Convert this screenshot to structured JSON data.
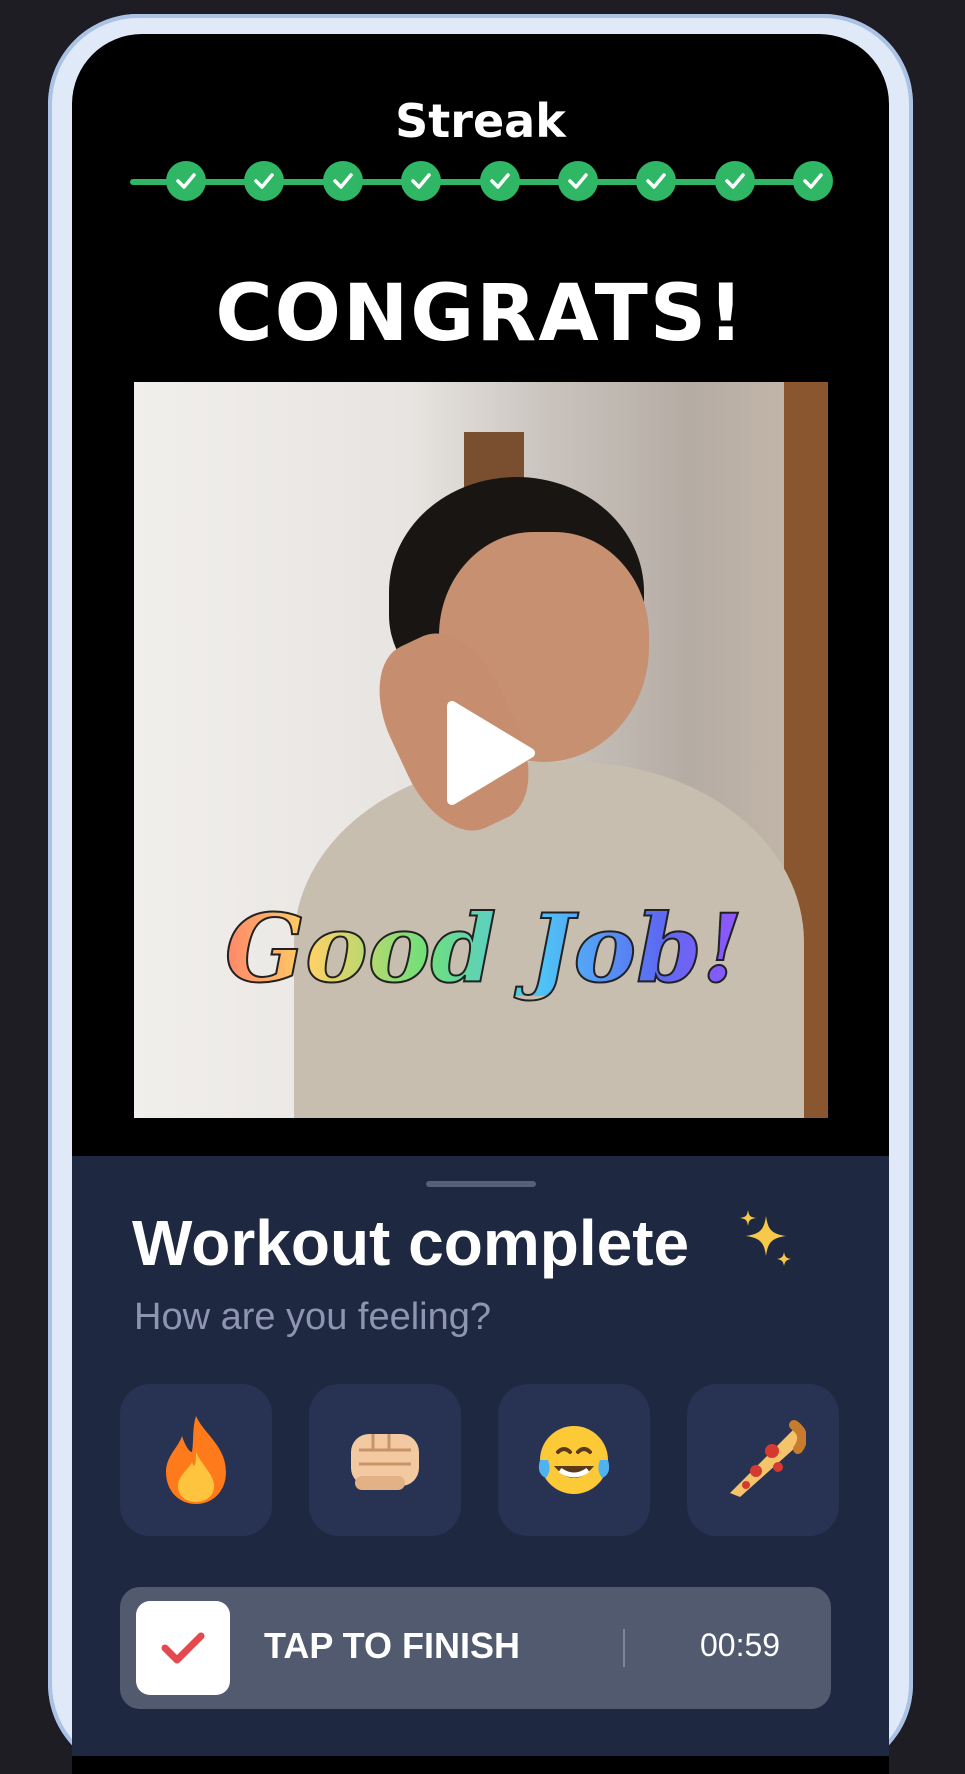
{
  "header": {
    "streak_title": "Streak",
    "streak_count": 9
  },
  "congrats_text": "CONGRATS!",
  "gif": {
    "caption": "Good Job!"
  },
  "sheet": {
    "title": "Workout complete",
    "subtitle": "How are you feeling?",
    "reactions": [
      {
        "icon": "fire-icon",
        "glyph": "🔥"
      },
      {
        "icon": "fist-icon",
        "glyph": "👊"
      },
      {
        "icon": "laughing-tears-icon",
        "glyph": "😂"
      },
      {
        "icon": "pizza-icon",
        "glyph": "🍕"
      }
    ],
    "finish": {
      "label": "TAP TO FINISH",
      "timer": "00:59"
    }
  },
  "colors": {
    "accent_green": "#2fb766",
    "sheet_bg": "#1f2841",
    "finish_bar": "#525a70"
  }
}
